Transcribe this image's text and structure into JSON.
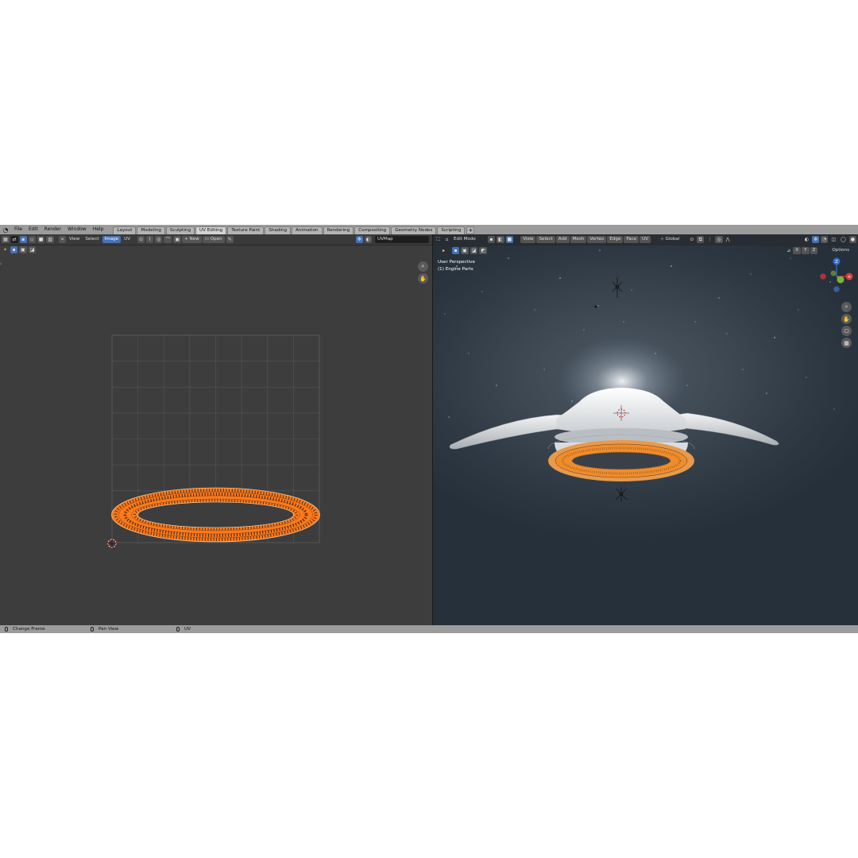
{
  "menu": [
    "File",
    "Edit",
    "Render",
    "Window",
    "Help"
  ],
  "workspaces": {
    "tabs": [
      "Layout",
      "Modeling",
      "Sculpting",
      "UV Editing",
      "Texture Paint",
      "Shading",
      "Animation",
      "Rendering",
      "Compositing",
      "Geometry Nodes",
      "Scripting"
    ],
    "active": "UV Editing",
    "add_label": "+"
  },
  "uv_editor": {
    "header": {
      "menus": [
        "View",
        "Select",
        "Image",
        "UV"
      ],
      "active_menu": "Image",
      "new_label": "New",
      "open_label": "Open",
      "uvmap_field": "UVMap"
    },
    "colors": {
      "uv_island": "#ff7a1a",
      "edges": "#1a1a1a"
    }
  },
  "viewport": {
    "header": {
      "mode": "Edit Mode",
      "menus": [
        "View",
        "Select",
        "Add",
        "Mesh",
        "Vertex",
        "Edge",
        "Face",
        "UV"
      ],
      "transform_orientation": "Global",
      "options_label": "Options",
      "axis_lock": [
        "X",
        "Y",
        "Z"
      ]
    },
    "overlay_text": {
      "perspective": "User Perspective",
      "object": "(1) Engine Parts"
    },
    "gizmo": {
      "z_label": "Z"
    }
  },
  "status_bar": {
    "items": [
      "Change Frame",
      "Pan View",
      "UV"
    ]
  }
}
